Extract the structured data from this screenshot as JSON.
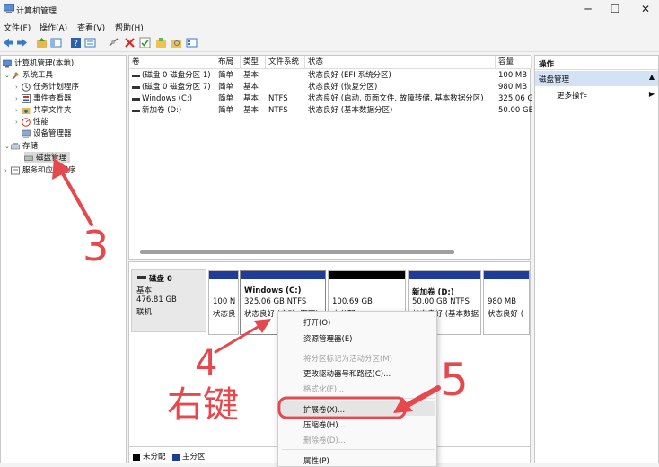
{
  "window": {
    "title": "计算机管理"
  },
  "window_controls": {
    "minimize": "─",
    "maximize": "☐",
    "close": "✕"
  },
  "menu": [
    "文件(F)",
    "操作(A)",
    "查看(V)",
    "帮助(H)"
  ],
  "tree": {
    "root": "计算机管理(本地)",
    "system_tools": "系统工具",
    "items": [
      "任务计划程序",
      "事件查看器",
      "共享文件夹",
      "性能",
      "设备管理器"
    ],
    "storage": "存储",
    "disk_mgmt": "磁盘管理",
    "services": "服务和应用程序"
  },
  "volume_table": {
    "headers": [
      "卷",
      "布局",
      "类型",
      "文件系统",
      "状态",
      "容量"
    ],
    "rows": [
      [
        "(磁盘 0 磁盘分区 1)",
        "简单",
        "基本",
        "",
        "状态良好 (EFI 系统分区)",
        "100 MB"
      ],
      [
        "(磁盘 0 磁盘分区 7)",
        "简单",
        "基本",
        "",
        "状态良好 (恢复分区)",
        "980 MB"
      ],
      [
        "Windows (C:)",
        "简单",
        "基本",
        "NTFS",
        "状态良好 (启动, 页面文件, 故障转储, 基本数据分区)",
        "325.06 G"
      ],
      [
        "新加卷 (D:)",
        "简单",
        "基本",
        "NTFS",
        "状态良好 (基本数据分区)",
        "50.00 GE"
      ]
    ]
  },
  "disk": {
    "name": "磁盘 0",
    "type": "基本",
    "size": "476.81 GB",
    "status": "联机"
  },
  "partitions": [
    {
      "line1": "",
      "line2": "100 N",
      "line3": "状态良"
    },
    {
      "line1": "Windows (C:)",
      "line2": "325.06 GB NTFS",
      "line3": "状态良好 (启动, 页面)"
    },
    {
      "line1": "",
      "line2": "100.69 GB",
      "line3": "未分配"
    },
    {
      "line1": "新加卷 (D:)",
      "line2": "50.00 GB NTFS",
      "line3": "状态良好 (基本数据"
    },
    {
      "line1": "",
      "line2": "980 MB",
      "line3": "状态良好 ("
    }
  ],
  "legend": {
    "unallocated": "未分配",
    "primary": "主分区"
  },
  "actions": {
    "header": "操作",
    "section": "磁盘管理",
    "more": "更多操作"
  },
  "context_menu": [
    {
      "label": "打开(O)",
      "enabled": true
    },
    {
      "label": "资源管理器(E)",
      "enabled": true
    },
    {
      "label": "将分区标记为活动分区(M)",
      "enabled": false
    },
    {
      "label": "更改驱动器号和路径(C)...",
      "enabled": true
    },
    {
      "label": "格式化(F)...",
      "enabled": false
    },
    {
      "label": "扩展卷(X)...",
      "enabled": true
    },
    {
      "label": "压缩卷(H)...",
      "enabled": true
    },
    {
      "label": "删除卷(D)...",
      "enabled": false
    },
    {
      "label": "属性(P)",
      "enabled": true
    }
  ],
  "annotations": {
    "step3": "3",
    "step4": "4",
    "step4_text": "右键",
    "step5": "5"
  },
  "colors": {
    "primary_partition": "#1f3c9a",
    "unallocated": "#000000",
    "annotation": "#e5484d"
  }
}
